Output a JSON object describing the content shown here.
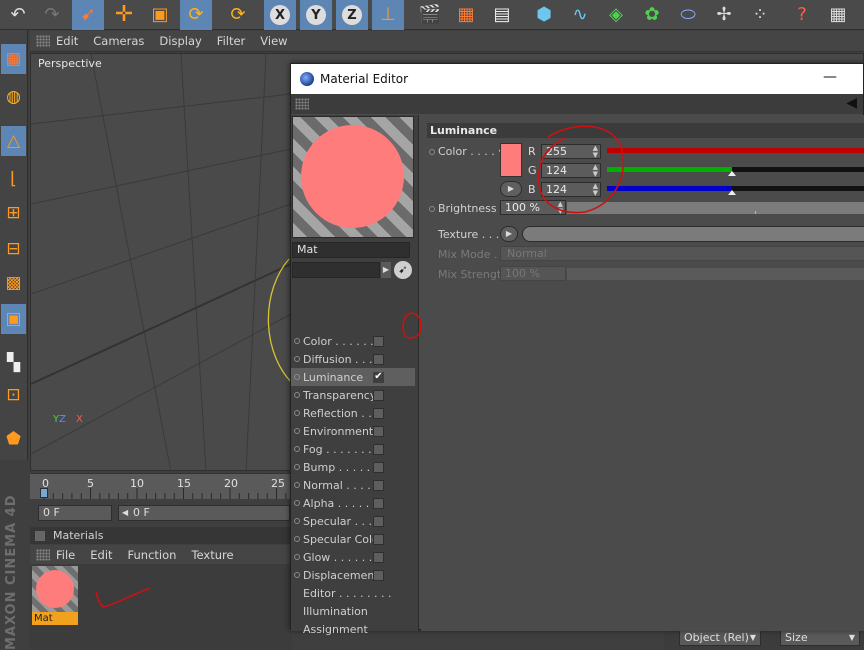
{
  "colors": {
    "selection": "#5d86b5",
    "material_color": "#ff7c7c",
    "annotation": "#cc1111",
    "slider_red": "#c00000",
    "slider_green": "#00b000",
    "slider_blue": "#0000c8",
    "material_tag": "#f2a11e"
  },
  "toolbar": {
    "icons": [
      "undo-icon",
      "redo-icon",
      "live-selection-icon",
      "move-icon",
      "scale-icon",
      "rotate-icon",
      "rotate-recent-icon",
      "x-axis-icon",
      "y-axis-icon",
      "z-axis-icon",
      "world-coordinates-icon",
      "render-view-icon",
      "render-picture-viewer-icon",
      "render-settings-icon",
      "cube-icon",
      "spline-pen-icon",
      "subdivision-icon",
      "array-icon",
      "deformer-icon",
      "scene-icon",
      "particles-icon",
      "help-icon",
      "tags-icon"
    ]
  },
  "lefttoolbar": {
    "icons": [
      "viewport-layout-icon",
      "sphere-points-icon",
      "model-mode-icon",
      "texture-axis-icon",
      "points-mode-icon",
      "edges-mode-icon",
      "polygons-mode-icon",
      "uv-mode-icon",
      "checkerboard-icon",
      "snap-icon",
      "workplane-icon"
    ]
  },
  "viewport": {
    "menu": [
      "Edit",
      "Cameras",
      "Display",
      "Filter",
      "View"
    ],
    "label": "Perspective",
    "axes": {
      "y": "Y",
      "z": "Z",
      "x": "X"
    }
  },
  "timeline": {
    "ticks": [
      "0",
      "5",
      "10",
      "15",
      "20",
      "25"
    ],
    "start_frame": "0 F",
    "current_frame": "0 F"
  },
  "materials": {
    "title": "Materials",
    "menu": [
      "File",
      "Edit",
      "Function",
      "Texture"
    ],
    "items": [
      {
        "name": "Mat"
      }
    ]
  },
  "attributes": {
    "mode": "Object (Rel)",
    "size": "Size"
  },
  "brand": "MAXON CINEMA 4D",
  "editor": {
    "title": "Material Editor",
    "material_name": "Mat",
    "channels": [
      {
        "label": "Color . . . . . . . .",
        "checked": false,
        "has_checkbox": true,
        "selected": false
      },
      {
        "label": "Diffusion . . . . . .",
        "checked": false,
        "has_checkbox": true,
        "selected": false
      },
      {
        "label": "Luminance",
        "checked": true,
        "has_checkbox": true,
        "selected": true
      },
      {
        "label": "Transparency",
        "checked": false,
        "has_checkbox": true,
        "selected": false
      },
      {
        "label": "Reflection . . . .",
        "checked": false,
        "has_checkbox": true,
        "selected": false
      },
      {
        "label": "Environment",
        "checked": false,
        "has_checkbox": true,
        "selected": false
      },
      {
        "label": "Fog . . . . . . . . .",
        "checked": false,
        "has_checkbox": true,
        "selected": false
      },
      {
        "label": "Bump . . . . . . . .",
        "checked": false,
        "has_checkbox": true,
        "selected": false
      },
      {
        "label": "Normal . . . . . . .",
        "checked": false,
        "has_checkbox": true,
        "selected": false
      },
      {
        "label": "Alpha . . . . . . . .",
        "checked": false,
        "has_checkbox": true,
        "selected": false
      },
      {
        "label": "Specular . . . . .",
        "checked": false,
        "has_checkbox": true,
        "selected": false
      },
      {
        "label": "Specular Color",
        "checked": false,
        "has_checkbox": true,
        "selected": false
      },
      {
        "label": "Glow . . . . . . . .",
        "checked": false,
        "has_checkbox": true,
        "selected": false
      },
      {
        "label": "Displacement",
        "checked": false,
        "has_checkbox": true,
        "selected": false
      },
      {
        "label": "Editor . . . . . . . .",
        "checked": false,
        "has_checkbox": false,
        "selected": false
      },
      {
        "label": "Illumination",
        "checked": false,
        "has_checkbox": false,
        "selected": false
      },
      {
        "label": "Assignment",
        "checked": false,
        "has_checkbox": false,
        "selected": false
      }
    ],
    "luminance": {
      "header": "Luminance",
      "color_label": "Color . . . .",
      "r_label": "R",
      "r_value": "255",
      "r_fraction": 1.0,
      "g_label": "G",
      "g_value": "124",
      "g_fraction": 0.486,
      "b_label": "B",
      "b_value": "124",
      "b_fraction": 0.486,
      "brightness_label": "Brightness",
      "brightness_value": "100 %",
      "texture_label": "Texture . . . .",
      "mix_mode_label": "Mix Mode . .",
      "mix_mode_value": "Normal",
      "mix_strength_label": "Mix Strength",
      "mix_strength_value": "100 %"
    }
  }
}
